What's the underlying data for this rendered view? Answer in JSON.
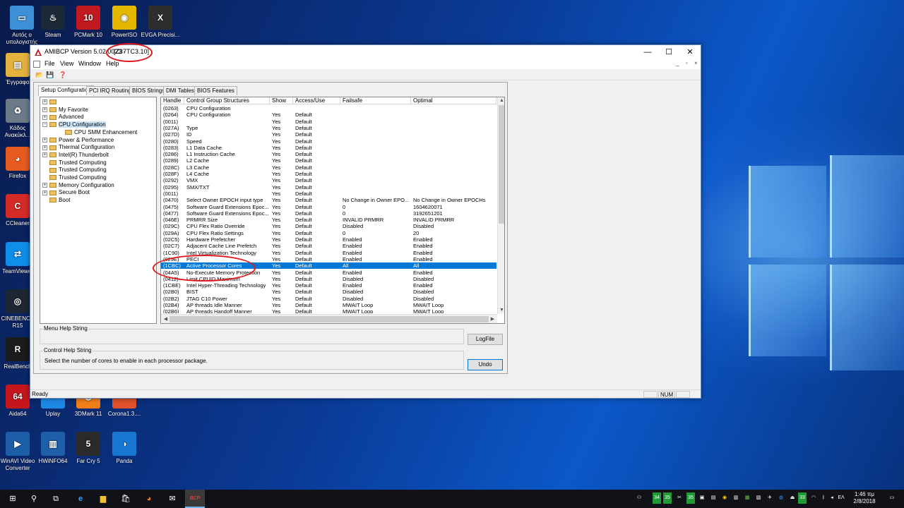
{
  "desktop": {
    "icons": [
      {
        "label": "Αυτός ο υπολογιστής",
        "icon": "computer-icon",
        "color": "#3d8fd6",
        "glyph": "▭"
      },
      {
        "label": "Steam",
        "icon": "steam-icon",
        "color": "#1b2838",
        "glyph": "♨"
      },
      {
        "label": "PCMark 10",
        "icon": "pcmark-icon",
        "color": "#c2181f",
        "glyph": "10"
      },
      {
        "label": "PowerISO",
        "icon": "poweriso-icon",
        "color": "#e5b800",
        "glyph": "◉"
      },
      {
        "label": "EVGA Precisi...",
        "icon": "evga-icon",
        "color": "#2e2e2e",
        "glyph": "X"
      },
      {
        "label": "Έγγραφα",
        "icon": "documents-icon",
        "color": "#e3b23c",
        "glyph": "▤"
      },
      {
        "label": "Κάδος Ανακύκλ...",
        "icon": "recycle-bin-icon",
        "color": "#6c7a89",
        "glyph": "♻"
      },
      {
        "label": "Firefox",
        "icon": "firefox-icon",
        "color": "#e55b1f",
        "glyph": "◕"
      },
      {
        "label": "CCleaner",
        "icon": "ccleaner-icon",
        "color": "#d42b26",
        "glyph": "C"
      },
      {
        "label": "TeamViewer",
        "icon": "teamviewer-icon",
        "color": "#0e8ee9",
        "glyph": "⇄"
      },
      {
        "label": "CINEBENCH R15",
        "icon": "cinebench-icon",
        "color": "#1d2733",
        "glyph": "◎"
      },
      {
        "label": "RealBench",
        "icon": "realbench-icon",
        "color": "#1b1b1b",
        "glyph": "R"
      },
      {
        "label": "Aida64",
        "icon": "aida64-icon",
        "color": "#c4161c",
        "glyph": "64"
      },
      {
        "label": "Uplay",
        "icon": "uplay-icon",
        "color": "#1e88e5",
        "glyph": "◐"
      },
      {
        "label": "3DMark 11",
        "icon": "3dmark-icon",
        "color": "#f07f1a",
        "glyph": "◍"
      },
      {
        "label": "Corona1.3....",
        "icon": "corona-icon",
        "color": "#e0522b",
        "glyph": "◌"
      },
      {
        "label": "WinAVI Video Converter",
        "icon": "winavi-icon",
        "color": "#1c5fa8",
        "glyph": "▶"
      },
      {
        "label": "HWiNFO64",
        "icon": "hwinfo-icon",
        "color": "#1f5ea8",
        "glyph": "▥"
      },
      {
        "label": "Far Cry 5",
        "icon": "farcry-icon",
        "color": "#2a2a2a",
        "glyph": "5"
      },
      {
        "label": "Panda",
        "icon": "panda-icon",
        "color": "#1976d2",
        "glyph": "◑"
      }
    ]
  },
  "window": {
    "title": "AMIBCP Version 5.02.0023",
    "rom_sep": " - ",
    "rom_name": "[Z37TC3.10]",
    "minimize": "—",
    "maximize": "☐",
    "close": "✕",
    "accent": "#0078d7"
  },
  "menu": {
    "items": [
      "File",
      "View",
      "Window",
      "Help"
    ],
    "mdi": [
      "_",
      "▫",
      "×"
    ]
  },
  "toolbar": {
    "open": "📂",
    "save": "💾",
    "help": "❓"
  },
  "tabs": [
    "Setup Configuration",
    "PCI IRQ Routing",
    "BIOS Strings",
    "DMI Tables",
    "BIOS Features"
  ],
  "tree": {
    "nodes": [
      {
        "label": "",
        "exp": "+"
      },
      {
        "label": "My Favorite",
        "exp": "+"
      },
      {
        "label": "Advanced",
        "exp": "+"
      },
      {
        "label": "CPU Configuration",
        "exp": "−",
        "selected": true
      },
      {
        "label": "CPU SMM Enhancement",
        "exp": "",
        "indent": 1
      },
      {
        "label": "Power & Performance",
        "exp": "+"
      },
      {
        "label": "Thermal Configuration",
        "exp": "+"
      },
      {
        "label": "Intel(R) Thunderbolt",
        "exp": "+"
      },
      {
        "label": "Trusted Computing",
        "exp": ""
      },
      {
        "label": "Trusted Computing",
        "exp": ""
      },
      {
        "label": "Trusted Computing",
        "exp": ""
      },
      {
        "label": "Memory Configuration",
        "exp": "+"
      },
      {
        "label": "Secure Boot",
        "exp": "+"
      },
      {
        "label": "Boot",
        "exp": ""
      }
    ]
  },
  "grid": {
    "columns": [
      "Handle",
      "Control Group Structures",
      "Show",
      "Access/Use",
      "Failsafe",
      "Optimal"
    ],
    "rows": [
      [
        "(0263)",
        "CPU Configuration",
        "",
        "",
        "",
        ""
      ],
      [
        "(0264)",
        "CPU Configuration",
        "Yes",
        "Default",
        "",
        ""
      ],
      [
        "(0011)",
        "",
        "Yes",
        "Default",
        "",
        ""
      ],
      [
        "(027A)",
        "Type",
        "Yes",
        "Default",
        "",
        ""
      ],
      [
        "(027D)",
        "ID",
        "Yes",
        "Default",
        "",
        ""
      ],
      [
        "(0280)",
        "Speed",
        "Yes",
        "Default",
        "",
        ""
      ],
      [
        "(0283)",
        "L1 Data Cache",
        "Yes",
        "Default",
        "",
        ""
      ],
      [
        "(0286)",
        "L1 Instruction Cache",
        "Yes",
        "Default",
        "",
        ""
      ],
      [
        "(0289)",
        "L2 Cache",
        "Yes",
        "Default",
        "",
        ""
      ],
      [
        "(028C)",
        "L3 Cache",
        "Yes",
        "Default",
        "",
        ""
      ],
      [
        "(028F)",
        "L4 Cache",
        "Yes",
        "Default",
        "",
        ""
      ],
      [
        "(0292)",
        "VMX",
        "Yes",
        "Default",
        "",
        ""
      ],
      [
        "(0295)",
        "SMX/TXT",
        "Yes",
        "Default",
        "",
        ""
      ],
      [
        "(0011)",
        "",
        "Yes",
        "Default",
        "",
        ""
      ],
      [
        "(0470)",
        "Select Owner EPOCH input type",
        "Yes",
        "Default",
        "No Change in Owner EPO...",
        "No Change in Owner EPOCHs"
      ],
      [
        "(0475)",
        "Software Guard Extensions Epoc...",
        "Yes",
        "Default",
        "0",
        "1604620071"
      ],
      [
        "(0477)",
        "Software Guard Extensions Epoc...",
        "Yes",
        "Default",
        "0",
        "3192651201"
      ],
      [
        "(046E)",
        "PRMRR Size",
        "Yes",
        "Default",
        "INVALID PRMRR",
        "INVALID PRMRR"
      ],
      [
        "(029C)",
        "CPU Flex Ratio Override",
        "Yes",
        "Default",
        "Disabled",
        "Disabled"
      ],
      [
        "(029A)",
        "CPU Flex Ratio Settings",
        "Yes",
        "Default",
        "0",
        "20"
      ],
      [
        "(02C5)",
        "Hardware Prefetcher",
        "Yes",
        "Default",
        "Enabled",
        "Enabled"
      ],
      [
        "(02C7)",
        "Adjacent Cache Line Prefetch",
        "Yes",
        "Default",
        "Enabled",
        "Enabled"
      ],
      [
        "(1C90)",
        "Intel Virtualization Technology",
        "Yes",
        "Default",
        "Enabled",
        "Enabled"
      ],
      [
        "(029E)",
        "PECI",
        "Yes",
        "Default",
        "Enabled",
        "Enabled"
      ],
      [
        "(1CBC)",
        "Active Processor Cores",
        "Yes",
        "Default",
        "All",
        "All"
      ],
      [
        "(04A5)",
        "No-Execute Memory Protection",
        "Yes",
        "Default",
        "Enabled",
        "Enabled"
      ],
      [
        "(0412)",
        "Limit CPUID Maximum",
        "Yes",
        "Default",
        "Disabled",
        "Disabled"
      ],
      [
        "(1CBE)",
        "Intel Hyper-Threading Technology",
        "Yes",
        "Default",
        "Enabled",
        "Enabled"
      ],
      [
        "(02B0)",
        "BIST",
        "Yes",
        "Default",
        "Disabled",
        "Disabled"
      ],
      [
        "(02B2)",
        "JTAG C10 Power",
        "Yes",
        "Default",
        "Disabled",
        "Disabled"
      ],
      [
        "(02B4)",
        "AP threads Idle Manner",
        "Yes",
        "Default",
        "MWAIT Loop",
        "MWAIT Loop"
      ],
      [
        "(02B6)",
        "AP threads Handoff Manner",
        "Yes",
        "Default",
        "MWAIT Loop",
        "MWAIT Loop"
      ]
    ],
    "selected_row": 24,
    "scroll_up": "▲",
    "scroll_down": "▼",
    "scroll_left": "◀",
    "scroll_right": "▶"
  },
  "help": {
    "menu_title": "Menu Help String",
    "menu_text": "",
    "control_title": "Control Help String",
    "control_text": "Select the number of cores to enable in each processor package."
  },
  "buttons": {
    "logfile": "LogFile",
    "undo": "Undo"
  },
  "status": {
    "text": "Ready",
    "num": "NUM"
  },
  "taskbar": {
    "start": "⊞",
    "search": "⚲",
    "taskview": "⧉",
    "edge": "e",
    "explorer": "▆",
    "store": "🛍",
    "firefox": "◕",
    "mail": "✉",
    "bcp": "BCP",
    "tray": [
      "34",
      "35",
      "35",
      "33"
    ],
    "lang": "EΛ",
    "time": "1:46 πμ",
    "date": "2/8/2018"
  },
  "annotations": {
    "color": "#e0161b"
  }
}
